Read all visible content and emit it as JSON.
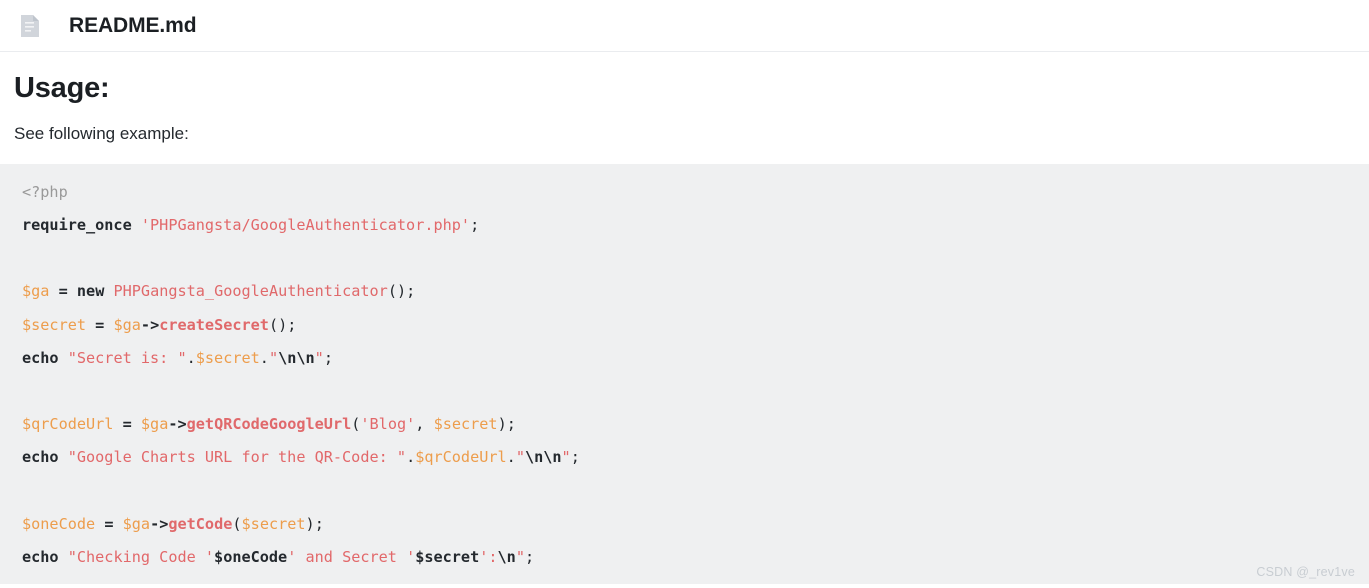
{
  "header": {
    "icon": "file-document-icon",
    "title": "README.md"
  },
  "document": {
    "heading": "Usage:",
    "paragraph": "See following example:"
  },
  "code": {
    "language": "php",
    "background_color": "#eff0f1",
    "colors": {
      "tag": "#999999",
      "keyword": "#24292e",
      "string": "#e2686a",
      "variable": "#ed9d4c",
      "class": "#e0696b",
      "function": "#e0696b",
      "punctuation": "#24292e"
    },
    "lines": [
      {
        "n": 1,
        "text": "<?php",
        "tokens": [
          {
            "t": "<?php",
            "k": "tag"
          }
        ]
      },
      {
        "n": 2,
        "text": "require_once 'PHPGangsta/GoogleAuthenticator.php';",
        "tokens": [
          {
            "t": "require_once",
            "k": "kw"
          },
          {
            "t": " ",
            "k": "plain"
          },
          {
            "t": "'PHPGangsta/GoogleAuthenticator.php'",
            "k": "str"
          },
          {
            "t": ";",
            "k": "punct"
          }
        ]
      },
      {
        "n": 3,
        "text": "",
        "tokens": []
      },
      {
        "n": 4,
        "text": "$ga = new PHPGangsta_GoogleAuthenticator();",
        "tokens": [
          {
            "t": "$ga",
            "k": "var"
          },
          {
            "t": " ",
            "k": "plain"
          },
          {
            "t": "=",
            "k": "op"
          },
          {
            "t": " ",
            "k": "plain"
          },
          {
            "t": "new",
            "k": "kw"
          },
          {
            "t": " ",
            "k": "plain"
          },
          {
            "t": "PHPGangsta_GoogleAuthenticator",
            "k": "class"
          },
          {
            "t": "();",
            "k": "punct"
          }
        ]
      },
      {
        "n": 5,
        "text": "$secret = $ga->createSecret();",
        "tokens": [
          {
            "t": "$secret",
            "k": "var"
          },
          {
            "t": " ",
            "k": "plain"
          },
          {
            "t": "=",
            "k": "op"
          },
          {
            "t": " ",
            "k": "plain"
          },
          {
            "t": "$ga",
            "k": "var"
          },
          {
            "t": "->",
            "k": "op"
          },
          {
            "t": "createSecret",
            "k": "fn"
          },
          {
            "t": "();",
            "k": "punct"
          }
        ]
      },
      {
        "n": 6,
        "text": "echo \"Secret is: \".$secret.\"\\n\\n\";",
        "tokens": [
          {
            "t": "echo",
            "k": "kw"
          },
          {
            "t": " ",
            "k": "plain"
          },
          {
            "t": "\"Secret is: \"",
            "k": "str"
          },
          {
            "t": ".",
            "k": "punct"
          },
          {
            "t": "$secret",
            "k": "var"
          },
          {
            "t": ".",
            "k": "punct"
          },
          {
            "t": "\"",
            "k": "str"
          },
          {
            "t": "\\n\\n",
            "k": "esc"
          },
          {
            "t": "\"",
            "k": "str"
          },
          {
            "t": ";",
            "k": "punct"
          }
        ]
      },
      {
        "n": 7,
        "text": "",
        "tokens": []
      },
      {
        "n": 8,
        "text": "$qrCodeUrl = $ga->getQRCodeGoogleUrl('Blog', $secret);",
        "tokens": [
          {
            "t": "$qrCodeUrl",
            "k": "var"
          },
          {
            "t": " ",
            "k": "plain"
          },
          {
            "t": "=",
            "k": "op"
          },
          {
            "t": " ",
            "k": "plain"
          },
          {
            "t": "$ga",
            "k": "var"
          },
          {
            "t": "->",
            "k": "op"
          },
          {
            "t": "getQRCodeGoogleUrl",
            "k": "fn"
          },
          {
            "t": "(",
            "k": "punct"
          },
          {
            "t": "'Blog'",
            "k": "str"
          },
          {
            "t": ", ",
            "k": "punct"
          },
          {
            "t": "$secret",
            "k": "var"
          },
          {
            "t": ");",
            "k": "punct"
          }
        ]
      },
      {
        "n": 9,
        "text": "echo \"Google Charts URL for the QR-Code: \".$qrCodeUrl.\"\\n\\n\";",
        "tokens": [
          {
            "t": "echo",
            "k": "kw"
          },
          {
            "t": " ",
            "k": "plain"
          },
          {
            "t": "\"Google Charts URL for the QR-Code: \"",
            "k": "str"
          },
          {
            "t": ".",
            "k": "punct"
          },
          {
            "t": "$qrCodeUrl",
            "k": "var"
          },
          {
            "t": ".",
            "k": "punct"
          },
          {
            "t": "\"",
            "k": "str"
          },
          {
            "t": "\\n\\n",
            "k": "esc"
          },
          {
            "t": "\"",
            "k": "str"
          },
          {
            "t": ";",
            "k": "punct"
          }
        ]
      },
      {
        "n": 10,
        "text": "",
        "tokens": []
      },
      {
        "n": 11,
        "text": "$oneCode = $ga->getCode($secret);",
        "tokens": [
          {
            "t": "$oneCode",
            "k": "var"
          },
          {
            "t": " ",
            "k": "plain"
          },
          {
            "t": "=",
            "k": "op"
          },
          {
            "t": " ",
            "k": "plain"
          },
          {
            "t": "$ga",
            "k": "var"
          },
          {
            "t": "->",
            "k": "op"
          },
          {
            "t": "getCode",
            "k": "fn"
          },
          {
            "t": "(",
            "k": "punct"
          },
          {
            "t": "$secret",
            "k": "var"
          },
          {
            "t": ");",
            "k": "punct"
          }
        ]
      },
      {
        "n": 12,
        "text": "echo \"Checking Code '$oneCode' and Secret '$secret':\\n\";",
        "tokens": [
          {
            "t": "echo",
            "k": "kw"
          },
          {
            "t": " ",
            "k": "plain"
          },
          {
            "t": "\"Checking Code '",
            "k": "str"
          },
          {
            "t": "$oneCode",
            "k": "interp"
          },
          {
            "t": "' and Secret '",
            "k": "str"
          },
          {
            "t": "$secret",
            "k": "interp"
          },
          {
            "t": "':",
            "k": "str"
          },
          {
            "t": "\\n",
            "k": "esc"
          },
          {
            "t": "\"",
            "k": "str"
          },
          {
            "t": ";",
            "k": "punct"
          }
        ]
      }
    ]
  },
  "watermark": {
    "text": "CSDN @_rev1ve"
  }
}
